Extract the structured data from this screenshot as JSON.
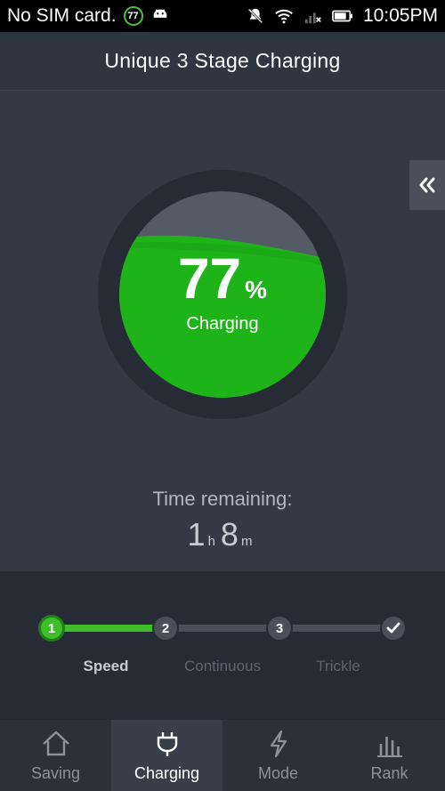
{
  "status_bar": {
    "carrier": "No SIM card.",
    "notification_badge": "77",
    "time": "10:05PM",
    "icons": [
      "android-icon",
      "mute-icon",
      "wifi-icon",
      "signal-icon",
      "battery-icon"
    ]
  },
  "header": {
    "title": "Unique 3 Stage Charging"
  },
  "gauge": {
    "percent": "77",
    "percent_sign": "%",
    "level_fraction": 0.77,
    "status": "Charging",
    "fill_color": "#1fb31a",
    "ring_color": "#262b35"
  },
  "time_remaining": {
    "label": "Time remaining:",
    "hours": "1",
    "hours_unit": "h",
    "minutes": "8",
    "minutes_unit": "m"
  },
  "stages": {
    "progress_fraction": 0.33,
    "nodes": [
      {
        "label": "1",
        "active": true
      },
      {
        "label": "2",
        "active": false
      },
      {
        "label": "3",
        "active": false
      },
      {
        "label": "check-icon",
        "active": false
      }
    ],
    "labels": [
      {
        "text": "Speed",
        "active": true
      },
      {
        "text": "Continuous",
        "active": false
      },
      {
        "text": "Trickle",
        "active": false
      }
    ],
    "accent_color": "#3fbd2b"
  },
  "nav": {
    "items": [
      {
        "label": "Saving",
        "icon": "home-icon",
        "active": false
      },
      {
        "label": "Charging",
        "icon": "plug-icon",
        "active": true
      },
      {
        "label": "Mode",
        "icon": "lightning-icon",
        "active": false
      },
      {
        "label": "Rank",
        "icon": "bar-chart-icon",
        "active": false
      }
    ]
  }
}
